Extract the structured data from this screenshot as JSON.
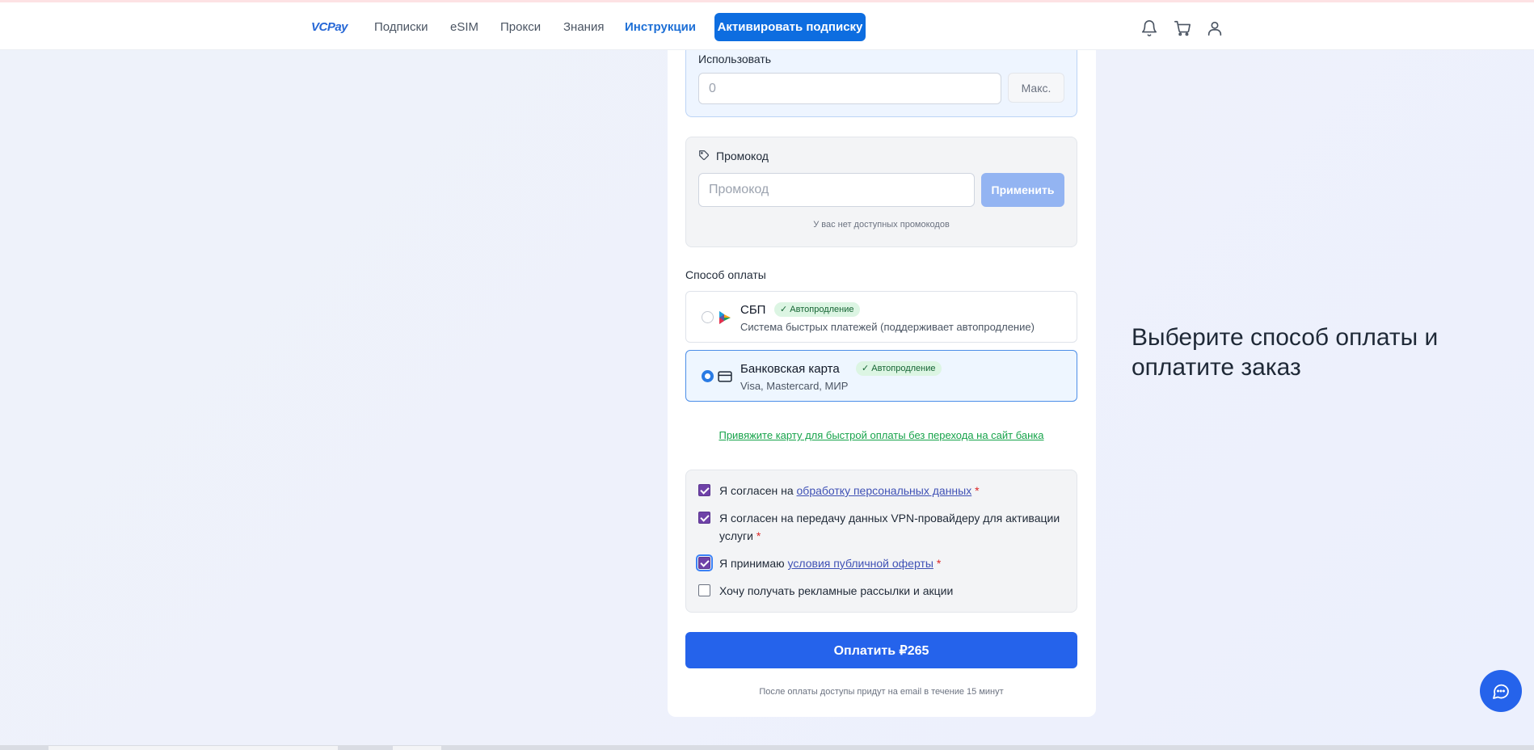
{
  "header": {
    "logo": "VCPay",
    "nav": [
      "Подписки",
      "eSIM",
      "Прокси",
      "Знания",
      "Инструкции"
    ],
    "active_nav": "Инструкции",
    "activate_label": "Активировать подписку"
  },
  "use_section": {
    "label": "Использовать",
    "input_value": "",
    "input_placeholder": "0",
    "max_label": "Макс."
  },
  "promo": {
    "label": "Промокод",
    "placeholder": "Промокод",
    "apply_label": "Применить",
    "hint": "У вас нет доступных промокодов"
  },
  "payment": {
    "label": "Способ оплаты",
    "methods": [
      {
        "title": "СБП",
        "badge": "✓ Автопродление",
        "subtitle": "Система быстрых платежей (поддерживает автопродление)",
        "selected": false
      },
      {
        "title": "Банковская карта",
        "badge": "✓ Автопродление",
        "subtitle": "Visa, Mastercard, МИР",
        "selected": true
      }
    ],
    "bind_card_link": "Привяжите карту для быстрой оплаты без перехода на сайт банка"
  },
  "consents": {
    "c1_prefix": "Я согласен на ",
    "c1_link": "обработку персональных данных",
    "c2_text": "Я согласен на передачу данных VPN-провайдеру для активации услуги",
    "c3_prefix": "Я принимаю ",
    "c3_link": "условия публичной оферты",
    "c4_text": "Хочу получать рекламные рассылки и акции",
    "required_mark": "*",
    "checked": [
      true,
      true,
      true,
      false
    ]
  },
  "pay": {
    "label": "Оплатить ₽265",
    "note": "После оплаты доступы придут на email в течение 15 минут"
  },
  "side": {
    "title": "Выберите способ оплаты и оплатите заказ"
  },
  "icons": {
    "header": [
      "bell-icon",
      "cart-icon",
      "user-icon"
    ],
    "promo": "tag-icon",
    "sbp": "sbp-logo-icon",
    "card": "credit-card-icon",
    "chat": "chat-bubble-icon"
  },
  "colors": {
    "accent": "#0d6de0",
    "pay_button": "#2563eb",
    "badge_bg": "#dcf5e3",
    "badge_text": "#166534",
    "checkbox": "#6f42a8",
    "link_green": "#16a34a"
  }
}
